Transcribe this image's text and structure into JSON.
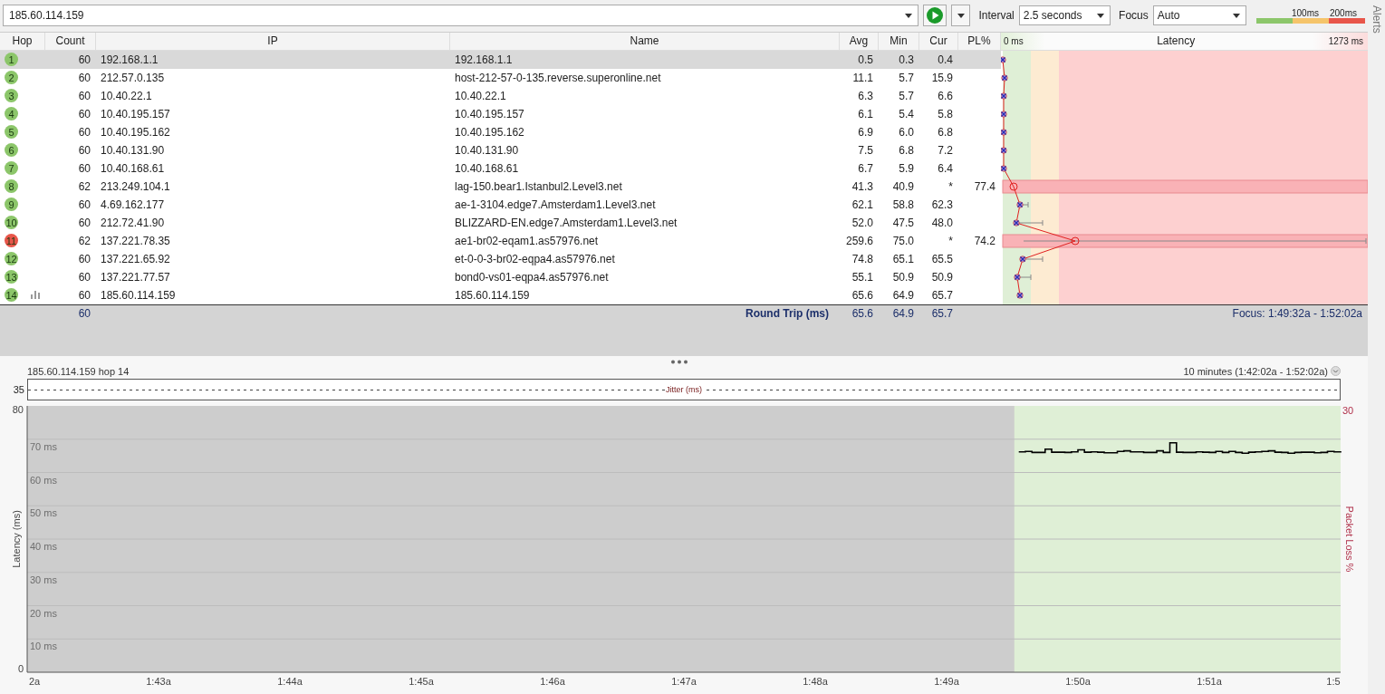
{
  "toolbar": {
    "target": "185.60.114.159",
    "interval_label": "Interval",
    "interval": "2.5 seconds",
    "focus_label": "Focus",
    "focus": "Auto",
    "legend": [
      "100ms",
      "200ms"
    ]
  },
  "alerts_tab": "Alerts",
  "table": {
    "columns": [
      "Hop",
      "Count",
      "IP",
      "Name",
      "Avg",
      "Min",
      "Cur",
      "PL%"
    ],
    "graph_header": {
      "min": "0 ms",
      "title": "Latency",
      "max": "1273 ms"
    },
    "rows": [
      {
        "hop": "1",
        "count": "60",
        "ip": "192.168.1.1",
        "name": "192.168.1.1",
        "avg": "0.5",
        "min": "0.3",
        "cur": "0.4",
        "pl": "",
        "color": "#8cc66a",
        "selected": true,
        "graph_shown": false
      },
      {
        "hop": "2",
        "count": "60",
        "ip": "212.57.0.135",
        "name": "host-212-57-0-135.reverse.superonline.net",
        "avg": "11.1",
        "min": "5.7",
        "cur": "15.9",
        "pl": "",
        "color": "#8cc66a",
        "selected": false,
        "graph_shown": false
      },
      {
        "hop": "3",
        "count": "60",
        "ip": "10.40.22.1",
        "name": "10.40.22.1",
        "avg": "6.3",
        "min": "5.7",
        "cur": "6.6",
        "pl": "",
        "color": "#8cc66a",
        "selected": false,
        "graph_shown": false
      },
      {
        "hop": "4",
        "count": "60",
        "ip": "10.40.195.157",
        "name": "10.40.195.157",
        "avg": "6.1",
        "min": "5.4",
        "cur": "5.8",
        "pl": "",
        "color": "#8cc66a",
        "selected": false,
        "graph_shown": false
      },
      {
        "hop": "5",
        "count": "60",
        "ip": "10.40.195.162",
        "name": "10.40.195.162",
        "avg": "6.9",
        "min": "6.0",
        "cur": "6.8",
        "pl": "",
        "color": "#8cc66a",
        "selected": false,
        "graph_shown": false
      },
      {
        "hop": "6",
        "count": "60",
        "ip": "10.40.131.90",
        "name": "10.40.131.90",
        "avg": "7.5",
        "min": "6.8",
        "cur": "7.2",
        "pl": "",
        "color": "#8cc66a",
        "selected": false,
        "graph_shown": false
      },
      {
        "hop": "7",
        "count": "60",
        "ip": "10.40.168.61",
        "name": "10.40.168.61",
        "avg": "6.7",
        "min": "5.9",
        "cur": "6.4",
        "pl": "",
        "color": "#8cc66a",
        "selected": false,
        "graph_shown": false
      },
      {
        "hop": "8",
        "count": "62",
        "ip": "213.249.104.1",
        "name": "lag-150.bear1.Istanbul2.Level3.net",
        "avg": "41.3",
        "min": "40.9",
        "cur": "*",
        "pl": "77.4",
        "color": "#8cc66a",
        "selected": false,
        "graph_shown": false
      },
      {
        "hop": "9",
        "count": "60",
        "ip": "4.69.162.177",
        "name": "ae-1-3104.edge7.Amsterdam1.Level3.net",
        "avg": "62.1",
        "min": "58.8",
        "cur": "62.3",
        "pl": "",
        "color": "#8cc66a",
        "selected": false,
        "graph_shown": false
      },
      {
        "hop": "10",
        "count": "60",
        "ip": "212.72.41.90",
        "name": "BLIZZARD-EN.edge7.Amsterdam1.Level3.net",
        "avg": "52.0",
        "min": "47.5",
        "cur": "48.0",
        "pl": "",
        "color": "#8cc66a",
        "selected": false,
        "graph_shown": false
      },
      {
        "hop": "11",
        "count": "62",
        "ip": "137.221.78.35",
        "name": "ae1-br02-eqam1.as57976.net",
        "avg": "259.6",
        "min": "75.0",
        "cur": "*",
        "pl": "74.2",
        "color": "#e8564a",
        "selected": false,
        "graph_shown": false
      },
      {
        "hop": "12",
        "count": "60",
        "ip": "137.221.65.92",
        "name": "et-0-0-3-br02-eqpa4.as57976.net",
        "avg": "74.8",
        "min": "65.1",
        "cur": "65.5",
        "pl": "",
        "color": "#8cc66a",
        "selected": false,
        "graph_shown": false
      },
      {
        "hop": "13",
        "count": "60",
        "ip": "137.221.77.57",
        "name": "bond0-vs01-eqpa4.as57976.net",
        "avg": "55.1",
        "min": "50.9",
        "cur": "50.9",
        "pl": "",
        "color": "#8cc66a",
        "selected": false,
        "graph_shown": false
      },
      {
        "hop": "14",
        "count": "60",
        "ip": "185.60.114.159",
        "name": "185.60.114.159",
        "avg": "65.6",
        "min": "64.9",
        "cur": "65.7",
        "pl": "",
        "color": "#8cc66a",
        "selected": false,
        "graph_shown": true
      }
    ],
    "summary": {
      "count": "60",
      "label": "Round Trip (ms)",
      "avg": "65.6",
      "min": "64.9",
      "cur": "65.7",
      "focus": "Focus: 1:49:32a - 1:52:02a"
    }
  },
  "timeline": {
    "target": "185.60.114.159 hop 14",
    "range": "10 minutes (1:42:02a - 1:52:02a)",
    "cut_tick_label": "2a",
    "jitter": {
      "max": "35",
      "label": "Jitter (ms)"
    },
    "right_axis": {
      "max": "30",
      "label": "Packet Loss %"
    },
    "grid_labels": [
      "70 ms",
      "60 ms",
      "50 ms",
      "40 ms",
      "30 ms",
      "20 ms",
      "10 ms"
    ],
    "chart_data": {
      "type": "line",
      "ylabel": "Latency (ms)",
      "xlim": [
        102,
        112
      ],
      "ylim": [
        0,
        80
      ],
      "yticks": [
        {
          "value": 0,
          "label": "0"
        },
        {
          "value": 80,
          "label": "80"
        }
      ],
      "xticks": [
        {
          "value": 103,
          "label": "1:43a"
        },
        {
          "value": 104,
          "label": "1:44a"
        },
        {
          "value": 105,
          "label": "1:45a"
        },
        {
          "value": 106,
          "label": "1:46a"
        },
        {
          "value": 107,
          "label": "1:47a"
        },
        {
          "value": 108,
          "label": "1:48a"
        },
        {
          "value": 109,
          "label": "1:49a"
        },
        {
          "value": 110,
          "label": "1:50a"
        },
        {
          "value": 111,
          "label": "1:51a"
        },
        {
          "value": 112,
          "label": "1:5"
        }
      ],
      "x": [
        109.55,
        109.6,
        109.65,
        109.7,
        109.75,
        109.8,
        109.85,
        109.9,
        109.95,
        110.0,
        110.05,
        110.1,
        110.15,
        110.2,
        110.25,
        110.3,
        110.35,
        110.4,
        110.45,
        110.5,
        110.55,
        110.6,
        110.65,
        110.7,
        110.75,
        110.8,
        110.85,
        110.9,
        110.95,
        111.0,
        111.05,
        111.1,
        111.15,
        111.2,
        111.25,
        111.3,
        111.35,
        111.4,
        111.45,
        111.5,
        111.55,
        111.6,
        111.65,
        111.7,
        111.75,
        111.8,
        111.85,
        111.9,
        111.95,
        112.0
      ],
      "series": [
        {
          "color": "#000000",
          "values": [
            66.2,
            66.3,
            66.0,
            66.0,
            67.0,
            66.1,
            66.1,
            66.0,
            66.2,
            66.8,
            66.1,
            66.2,
            66.1,
            65.9,
            65.9,
            66.3,
            66.5,
            66.2,
            66.2,
            66.0,
            66.0,
            66.5,
            66.0,
            68.9,
            66.1,
            66.0,
            66.0,
            66.2,
            66.1,
            66.0,
            66.3,
            66.0,
            66.3,
            66.0,
            65.8,
            66.1,
            66.2,
            66.3,
            66.5,
            66.1,
            66.0,
            65.8,
            66.0,
            66.1,
            66.1,
            65.9,
            66.0,
            66.3,
            66.2,
            66.0
          ]
        }
      ]
    }
  }
}
